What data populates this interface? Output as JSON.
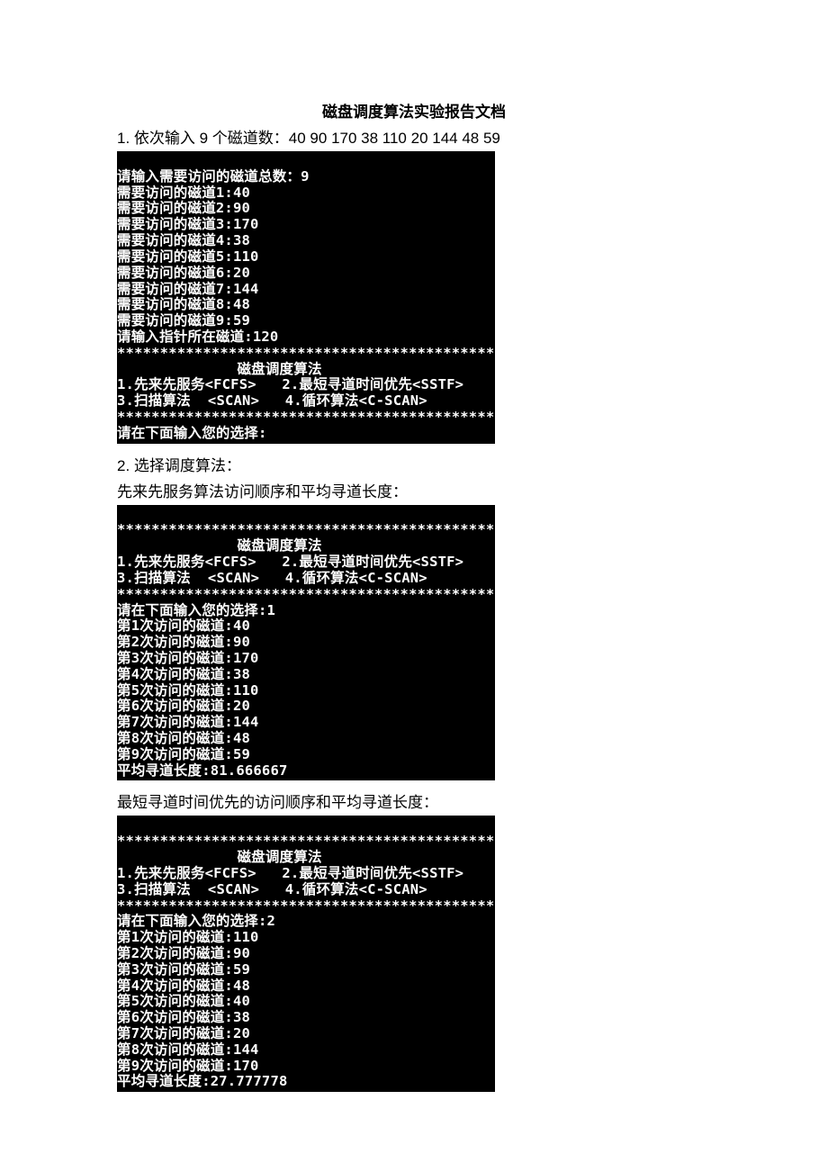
{
  "title": "磁盘调度算法实验报告文档",
  "caption1": "1. 依次输入 9 个磁道数：40 90 170 38 110 20 144 48 59",
  "term1": {
    "l0": "请输入需要访问的磁道总数：9",
    "l1": "需要访问的磁道1:40",
    "l2": "需要访问的磁道2:90",
    "l3": "需要访问的磁道3:170",
    "l4": "需要访问的磁道4:38",
    "l5": "需要访问的磁道5:110",
    "l6": "需要访问的磁道6:20",
    "l7": "需要访问的磁道7:144",
    "l8": "需要访问的磁道8:48",
    "l9": "需要访问的磁道9:59",
    "l10": "请输入指针所在磁道:120",
    "sep": "********************************************",
    "menu_title": "              磁盘调度算法",
    "menu_line1": "1.先来先服务<FCFS>   2.最短寻道时间优先<SSTF>",
    "menu_line2": "3.扫描算法  <SCAN>   4.循环算法<C-SCAN>",
    "prompt": "请在下面输入您的选择:"
  },
  "caption2a": "2. 选择调度算法：",
  "caption2b": "先来先服务算法访问顺序和平均寻道长度：",
  "term2": {
    "sep": "********************************************",
    "menu_title": "              磁盘调度算法",
    "menu_line1": "1.先来先服务<FCFS>   2.最短寻道时间优先<SSTF>",
    "menu_line2": "3.扫描算法  <SCAN>   4.循环算法<C-SCAN>",
    "prompt": "请在下面输入您的选择:1",
    "v1": "第1次访问的磁道:40",
    "v2": "第2次访问的磁道:90",
    "v3": "第3次访问的磁道:170",
    "v4": "第4次访问的磁道:38",
    "v5": "第5次访问的磁道:110",
    "v6": "第6次访问的磁道:20",
    "v7": "第7次访问的磁道:144",
    "v8": "第8次访问的磁道:48",
    "v9": "第9次访问的磁道:59",
    "avg": "平均寻道长度:81.666667"
  },
  "caption3": "最短寻道时间优先的访问顺序和平均寻道长度：",
  "term3": {
    "sep": "********************************************",
    "menu_title": "              磁盘调度算法",
    "menu_line1": "1.先来先服务<FCFS>   2.最短寻道时间优先<SSTF>",
    "menu_line2": "3.扫描算法  <SCAN>   4.循环算法<C-SCAN>",
    "prompt": "请在下面输入您的选择:2",
    "v1": "第1次访问的磁道:110",
    "v2": "第2次访问的磁道:90",
    "v3": "第3次访问的磁道:59",
    "v4": "第4次访问的磁道:48",
    "v5": "第5次访问的磁道:40",
    "v6": "第6次访问的磁道:38",
    "v7": "第7次访问的磁道:20",
    "v8": "第8次访问的磁道:144",
    "v9": "第9次访问的磁道:170",
    "avg": "平均寻道长度:27.777778"
  }
}
